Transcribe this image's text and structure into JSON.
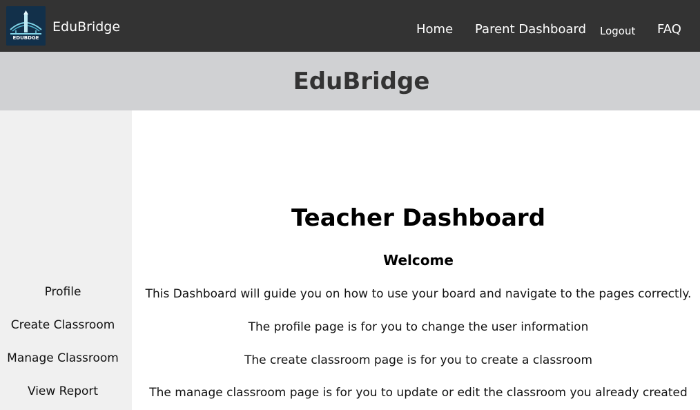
{
  "header": {
    "brand": "EduBridge",
    "logo_text": "EDUBDGE",
    "nav": {
      "home": "Home",
      "parent_dashboard": "Parent Dashboard",
      "logout": "Logout",
      "faq": "FAQ"
    }
  },
  "banner": {
    "title": "EduBridge"
  },
  "sidebar": {
    "items": [
      {
        "label": "Profile"
      },
      {
        "label": "Create Classroom"
      },
      {
        "label": "Manage Classroom"
      },
      {
        "label": "View Report"
      }
    ]
  },
  "main": {
    "title": "Teacher Dashboard",
    "welcome": "Welcome",
    "paragraphs": [
      "This Dashboard will guide you on how to use your board and navigate to the pages correctly.",
      "The profile page is for you to change the user information",
      "The create classroom page is for you to create a classroom",
      "The manage classroom page is for you to update or edit the classroom you already created"
    ]
  },
  "colors": {
    "topbar": "#333333",
    "banner": "#d0d1d3",
    "sidebar": "#f0f0f0"
  }
}
